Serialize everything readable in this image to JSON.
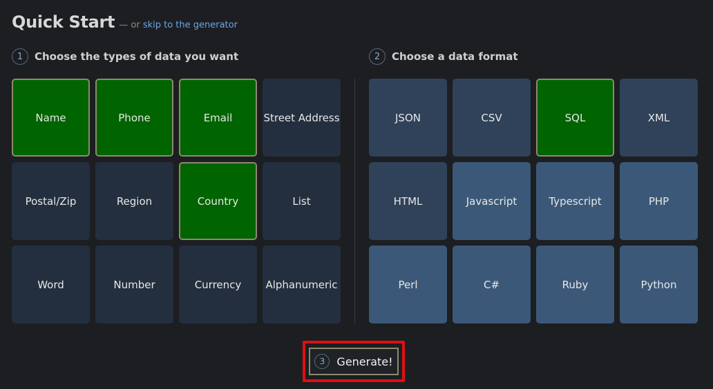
{
  "header": {
    "title": "Quick Start",
    "or_text": "— or",
    "skip_link": "skip to the generator"
  },
  "step1": {
    "number": "1",
    "title": "Choose the types of data you want",
    "tiles": [
      {
        "label": "Name",
        "selected": true
      },
      {
        "label": "Phone",
        "selected": true
      },
      {
        "label": "Email",
        "selected": true
      },
      {
        "label": "Street Address",
        "selected": false
      },
      {
        "label": "Postal/Zip",
        "selected": false
      },
      {
        "label": "Region",
        "selected": false
      },
      {
        "label": "Country",
        "selected": true
      },
      {
        "label": "List",
        "selected": false
      },
      {
        "label": "Word",
        "selected": false
      },
      {
        "label": "Number",
        "selected": false
      },
      {
        "label": "Currency",
        "selected": false
      },
      {
        "label": "Alphanumeric",
        "selected": false
      }
    ]
  },
  "step2": {
    "number": "2",
    "title": "Choose a data format",
    "tiles": [
      {
        "label": "JSON",
        "selected": false
      },
      {
        "label": "CSV",
        "selected": false
      },
      {
        "label": "SQL",
        "selected": true
      },
      {
        "label": "XML",
        "selected": false
      },
      {
        "label": "HTML",
        "selected": false
      },
      {
        "label": "Javascript",
        "selected": false
      },
      {
        "label": "Typescript",
        "selected": false
      },
      {
        "label": "PHP",
        "selected": false
      },
      {
        "label": "Perl",
        "selected": false
      },
      {
        "label": "C#",
        "selected": false
      },
      {
        "label": "Ruby",
        "selected": false
      },
      {
        "label": "Python",
        "selected": false
      }
    ]
  },
  "generate": {
    "number": "3",
    "label": "Generate!"
  },
  "colors": {
    "selected": "#006400",
    "tile_dark": "#232f3e",
    "tile_mid": "#2f4259",
    "tile_light": "#3b5878",
    "highlight_border": "#e01010",
    "link": "#6aa7e8"
  }
}
